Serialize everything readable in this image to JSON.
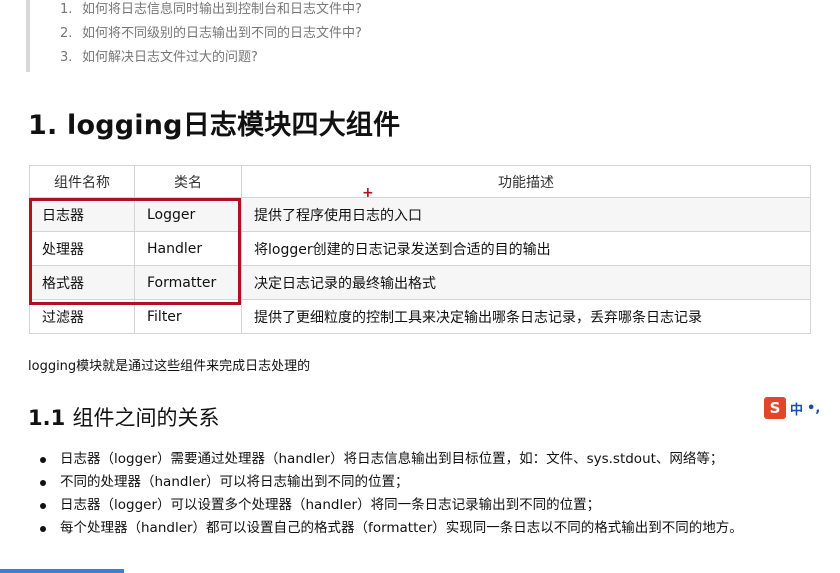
{
  "toc": [
    {
      "num": "1.",
      "text": "如何将日志信息同时输出到控制台和日志文件中?"
    },
    {
      "num": "2.",
      "text": "如何将不同级别的日志输出到不同的日志文件中?"
    },
    {
      "num": "3.",
      "text": "如何解决日志文件过大的问题?"
    }
  ],
  "section_title": "1. logging日志模块四大组件",
  "table": {
    "headers": [
      "组件名称",
      "类名",
      "功能描述"
    ],
    "rows": [
      [
        "日志器",
        "Logger",
        "提供了程序使用日志的入口"
      ],
      [
        "处理器",
        "Handler",
        "将logger创建的日志记录发送到合适的目的输出"
      ],
      [
        "格式器",
        "Formatter",
        "决定日志记录的最终输出格式"
      ],
      [
        "过滤器",
        "Filter",
        "提供了更细粒度的控制工具来决定输出哪条日志记录，丢弃哪条日志记录"
      ]
    ]
  },
  "cursor_glyph": "+",
  "summary": "logging模块就是通过这些组件来完成日志处理的",
  "subsection": {
    "num": "1.1",
    "title": "组件之间的关系"
  },
  "relations": [
    "日志器（logger）需要通过处理器（handler）将日志信息输出到目标位置，如：文件、sys.stdout、网络等；",
    "不同的处理器（handler）可以将日志输出到不同的位置；",
    "日志器（logger）可以设置多个处理器（handler）将同一条日志记录输出到不同的位置；",
    "每个处理器（handler）都可以设置自己的格式器（formatter）实现同一条日志以不同的格式输出到不同的地方。"
  ],
  "ime": {
    "logo": "S",
    "mode": "中",
    "punct": "•,"
  },
  "colors": {
    "highlight": "#b01020",
    "ime_logo": "#e2462a",
    "ime_text": "#1a4fa8"
  }
}
